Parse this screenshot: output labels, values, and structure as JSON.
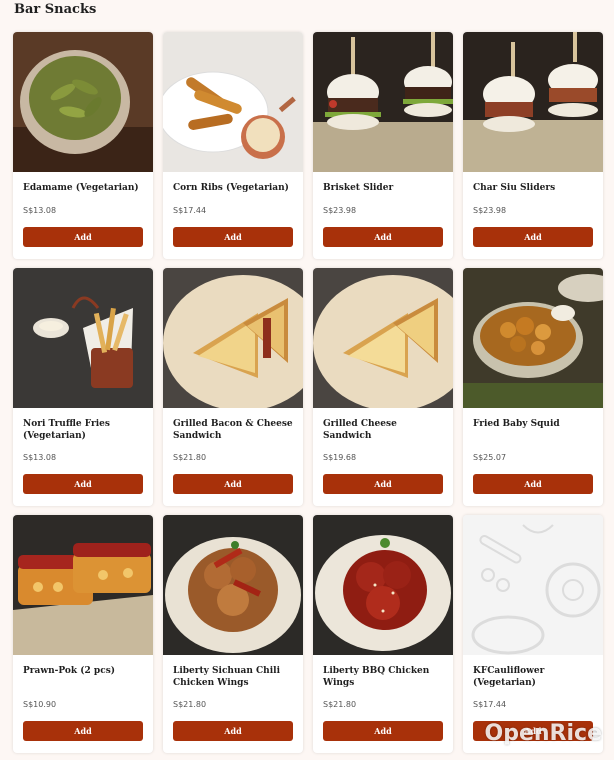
{
  "section": {
    "title": "Bar Snacks"
  },
  "items": [
    {
      "name": "Edamame (Vegetarian)",
      "price": "S$13.08",
      "add_label": "Add"
    },
    {
      "name": "Corn Ribs (Vegetarian)",
      "price": "S$17.44",
      "add_label": "Add"
    },
    {
      "name": "Brisket Slider",
      "price": "S$23.98",
      "add_label": "Add"
    },
    {
      "name": "Char Siu Sliders",
      "price": "S$23.98",
      "add_label": "Add"
    },
    {
      "name": "Nori Truffle Fries (Vegetarian)",
      "price": "S$13.08",
      "add_label": "Add"
    },
    {
      "name": "Grilled Bacon & Cheese Sandwich",
      "price": "S$21.80",
      "add_label": "Add"
    },
    {
      "name": "Grilled Cheese Sandwich",
      "price": "S$19.68",
      "add_label": "Add"
    },
    {
      "name": "Fried Baby Squid",
      "price": "S$25.07",
      "add_label": "Add"
    },
    {
      "name": "Prawn-Pok (2 pcs)",
      "price": "S$10.90",
      "add_label": "Add"
    },
    {
      "name": "Liberty Sichuan Chili Chicken Wings",
      "price": "S$21.80",
      "add_label": "Add"
    },
    {
      "name": "Liberty BBQ Chicken Wings",
      "price": "S$21.80",
      "add_label": "Add"
    },
    {
      "name": "KFCauliflower (Vegetarian)",
      "price": "S$17.44",
      "add_label": "Add"
    }
  ],
  "watermark": {
    "text": "OpenRice"
  },
  "colors": {
    "accent": "#a8310a",
    "background": "#fdf7f4"
  }
}
